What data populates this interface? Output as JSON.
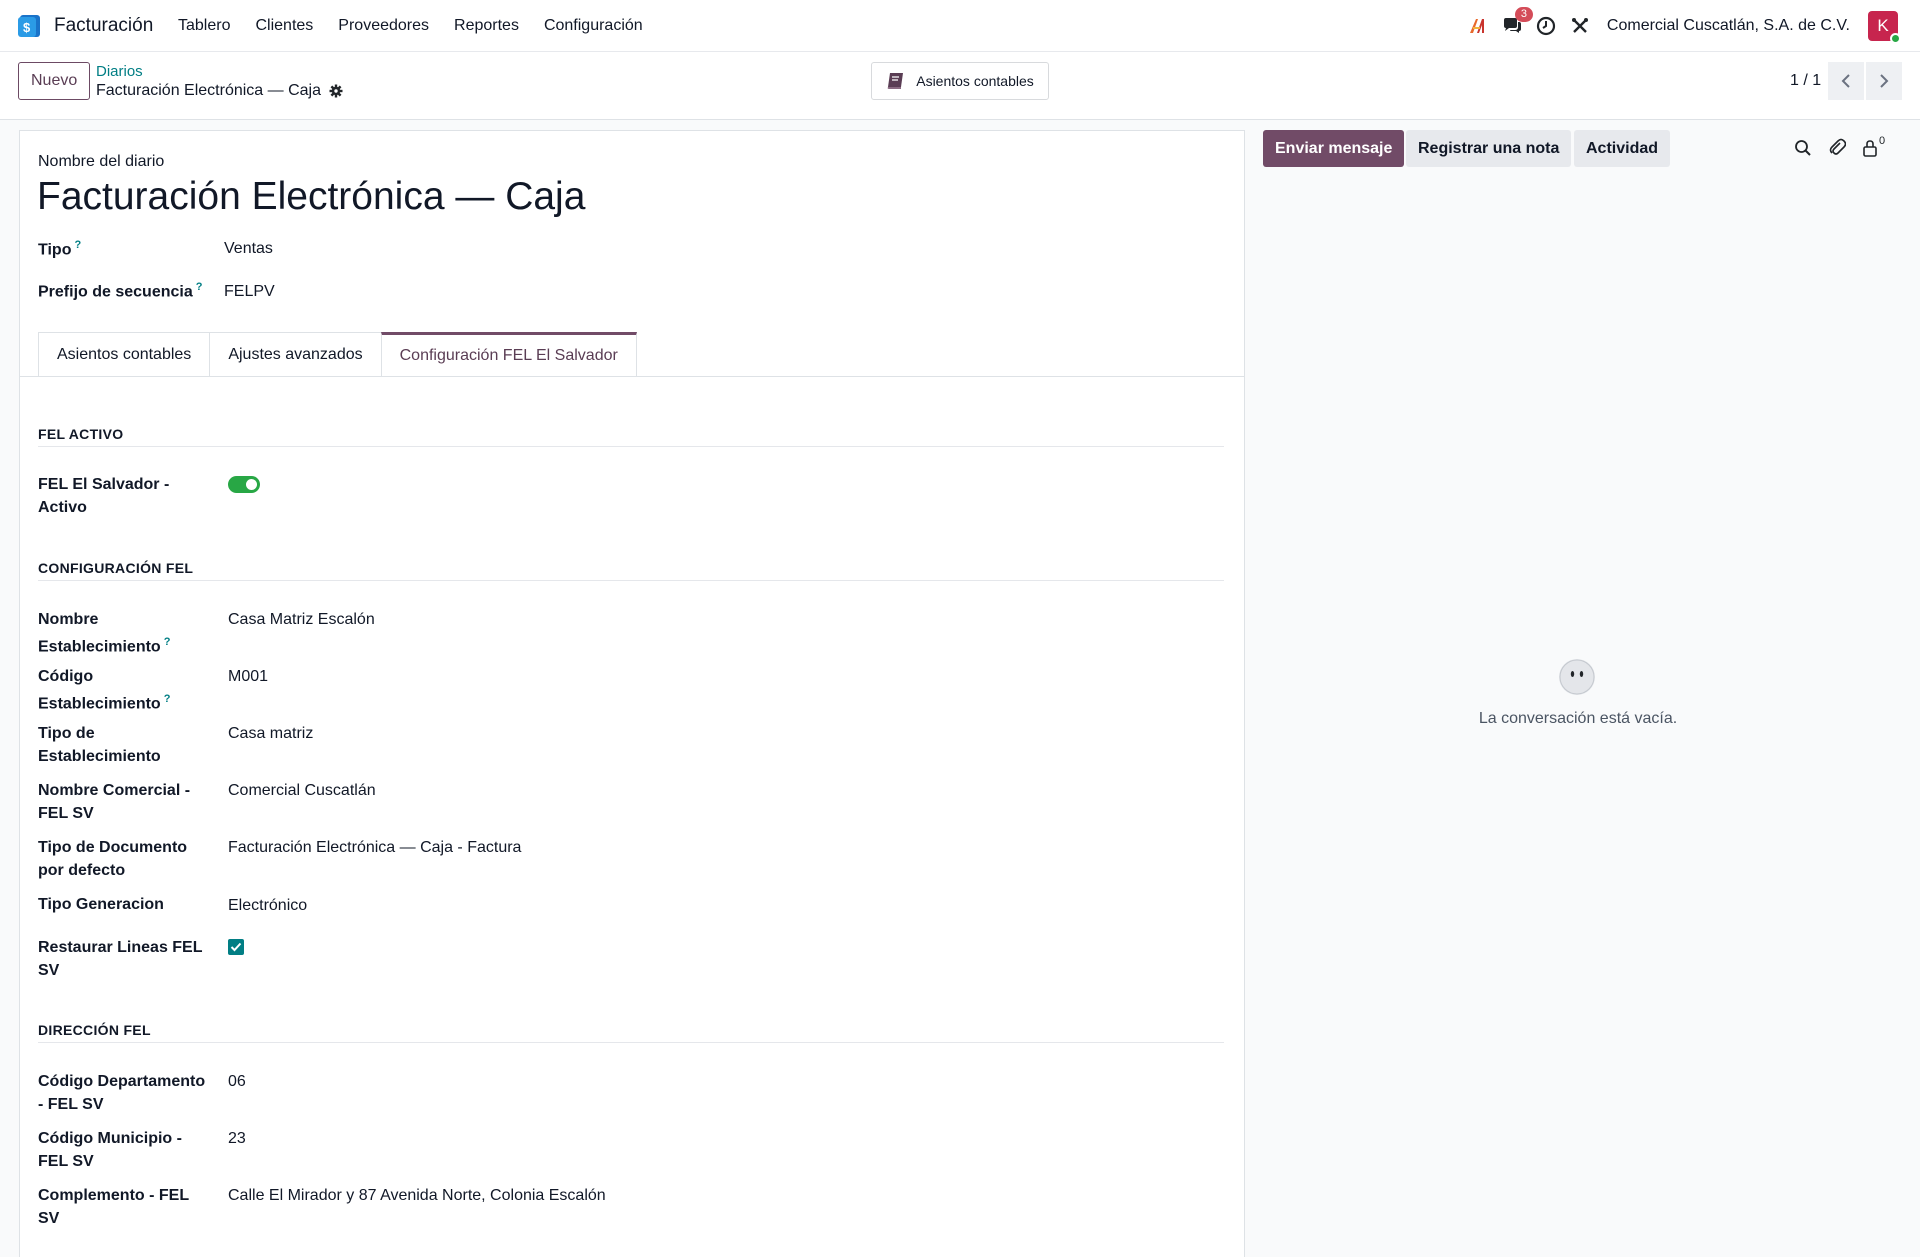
{
  "navbar": {
    "app_name": "Facturación",
    "menu": [
      "Tablero",
      "Clientes",
      "Proveedores",
      "Reportes",
      "Configuración"
    ],
    "messages_badge": "3",
    "company": "Comercial Cuscatlán, S.A. de C.V.",
    "avatar_letter": "K"
  },
  "control": {
    "new_label": "Nuevo",
    "breadcrumb_parent": "Diarios",
    "breadcrumb_current": "Facturación Electrónica — Caja",
    "smart_button_label": "Asientos contables",
    "pager": "1 / 1"
  },
  "form": {
    "name_label": "Nombre del diario",
    "name": "Facturación Electrónica — Caja",
    "tipo_label": "Tipo",
    "tipo_value": "Ventas",
    "prefijo_label": "Prefijo de secuencia",
    "prefijo_value": "FELPV",
    "tabs": [
      "Asientos contables",
      "Ajustes avanzados",
      "Configuración FEL El Salvador"
    ],
    "active_tab": "Configuración FEL El Salvador",
    "sections": {
      "fel_activo": "FEL ACTIVO",
      "configuracion": "CONFIGURACIÓN FEL",
      "direccion": "DIRECCIÓN FEL"
    },
    "fel_activo": {
      "label": "FEL El Salvador - Activo",
      "enabled": true
    },
    "config_fields": [
      {
        "label": "Nombre Establecimiento",
        "value": "Casa Matriz Escalón"
      },
      {
        "label": "Código Establecimiento",
        "value": "M001"
      },
      {
        "label": "Tipo de Establecimiento",
        "value": "Casa matriz"
      },
      {
        "label": "Nombre Comercial - FEL SV",
        "value": "Comercial Cuscatlán"
      },
      {
        "label": "Tipo de Documento por defecto",
        "value": "Facturación Electrónica — Caja - Factura"
      },
      {
        "label": "Tipo Generacion",
        "value": "Electrónico"
      },
      {
        "label": "Restaurar Lineas FEL SV",
        "checked": true
      }
    ],
    "address_fields": [
      {
        "label": "Código Departamento - FEL SV",
        "value": "06"
      },
      {
        "label": "Código Municipio - FEL SV",
        "value": "23"
      },
      {
        "label": "Complemento - FEL SV",
        "value": "Calle El Mirador y 87 Avenida Norte, Colonia Escalón"
      }
    ],
    "help_marker": "?"
  },
  "chatter": {
    "send_message": "Enviar mensaje",
    "log_note": "Registrar una nota",
    "activity": "Actividad",
    "followers_count": "0",
    "empty_text": "La conversación está vacía."
  },
  "colors": {
    "brand": "#714b67",
    "link": "#017e84",
    "toggle_on": "#28a745"
  }
}
